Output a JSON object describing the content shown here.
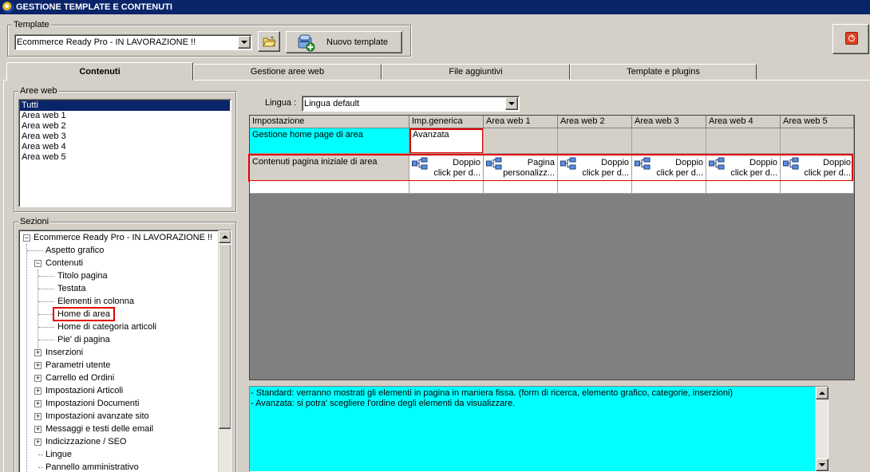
{
  "window": {
    "title": "GESTIONE TEMPLATE E CONTENUTI"
  },
  "template": {
    "group_label": "Template",
    "selected": "Ecommerce Ready Pro - IN LAVORAZIONE !!",
    "new_button_label": "Nuovo template"
  },
  "tabs": [
    {
      "label": "Contenuti"
    },
    {
      "label": "Gestione aree web"
    },
    {
      "label": "File aggiuntivi"
    },
    {
      "label": "Template e plugins"
    }
  ],
  "aree_web": {
    "group_label": "Aree web",
    "items": [
      "Tutti",
      "Area web 1",
      "Area web 2",
      "Area web 3",
      "Area web 4",
      "Area web 5"
    ],
    "selected": "Tutti"
  },
  "sezioni": {
    "group_label": "Sezioni",
    "tree": [
      {
        "label": "Ecommerce Ready Pro - IN LAVORAZIONE !!",
        "level": 0,
        "expander": "minus"
      },
      {
        "label": "Aspetto grafico",
        "level": 1,
        "expander": ""
      },
      {
        "label": "Contenuti",
        "level": 1,
        "expander": "minus"
      },
      {
        "label": "Titolo pagina",
        "level": 2,
        "expander": ""
      },
      {
        "label": "Testata",
        "level": 2,
        "expander": ""
      },
      {
        "label": "Elementi in colonna",
        "level": 2,
        "expander": ""
      },
      {
        "label": "Home di area",
        "level": 2,
        "expander": "",
        "highlighted": true
      },
      {
        "label": "Home di categoria articoli",
        "level": 2,
        "expander": ""
      },
      {
        "label": "Pie' di pagina",
        "level": 2,
        "expander": ""
      },
      {
        "label": "Inserzioni",
        "level": 1,
        "expander": "plus"
      },
      {
        "label": "Parametri utente",
        "level": 1,
        "expander": "plus"
      },
      {
        "label": "Carrello ed Ordini",
        "level": 1,
        "expander": "plus"
      },
      {
        "label": "Impostazioni Articoli",
        "level": 1,
        "expander": "plus"
      },
      {
        "label": "Impostazioni Documenti",
        "level": 1,
        "expander": "plus"
      },
      {
        "label": "Impostazioni avanzate sito",
        "level": 1,
        "expander": "plus"
      },
      {
        "label": "Messaggi e testi delle email",
        "level": 1,
        "expander": "plus"
      },
      {
        "label": "Indicizzazione / SEO",
        "level": 1,
        "expander": "plus"
      },
      {
        "label": "Lingue",
        "level": 1,
        "expander": ""
      },
      {
        "label": "Pannello amministrativo",
        "level": 1,
        "expander": ""
      }
    ]
  },
  "lingua": {
    "label": "Lingua :",
    "selected": "Lingua default"
  },
  "grid": {
    "headers": [
      "Impostazione",
      "Imp.generica",
      "Area web 1",
      "Area web 2",
      "Area web 3",
      "Area web 4",
      "Area web 5"
    ],
    "rows": [
      {
        "label": "Gestione home page di area",
        "cells": [
          "Avanzata",
          "",
          "",
          "",
          "",
          ""
        ]
      },
      {
        "label": "Contenuti pagina iniziale di area",
        "cells": [
          [
            "Doppio",
            "click per d..."
          ],
          [
            "Pagina",
            "personalizz..."
          ],
          [
            "Doppio",
            "click per d..."
          ],
          [
            "Doppio",
            "click per d..."
          ],
          [
            "Doppio",
            "click per d..."
          ],
          [
            "Doppio",
            "click per d..."
          ]
        ]
      }
    ]
  },
  "description": {
    "lines": [
      "- Standard: verranno mostrati gli elementi in pagina in maniera fissa. (form di ricerca, elemento grafico, categorie, inserzioni)",
      "- Avanzata: si potra' scegliere l'ordine degli elementi da visualizzare."
    ]
  },
  "colors": {
    "title_bar": "#0a246a",
    "highlight_cyan": "#00ffff",
    "selection_red": "#e00000"
  },
  "icons": [
    "app-icon",
    "folder-icon",
    "new-template-icon",
    "power-icon",
    "tree-structure-icon"
  ]
}
